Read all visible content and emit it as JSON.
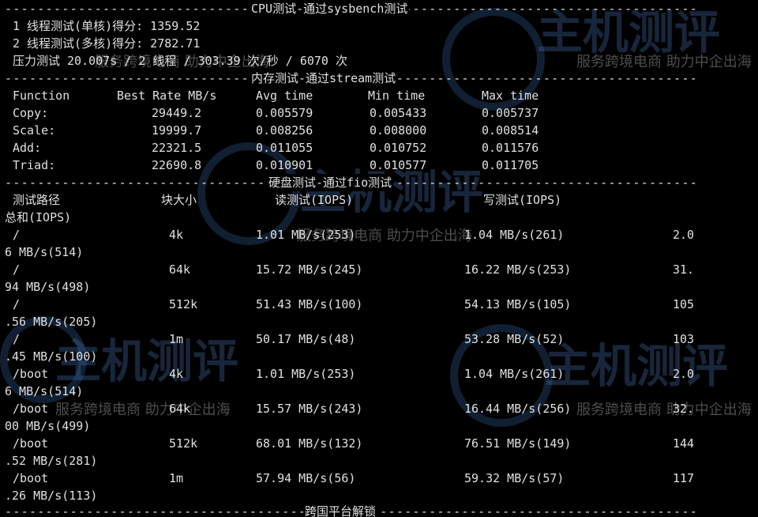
{
  "cpu": {
    "divider_title": "CPU测试-通过sysbench测试",
    "single_core": "1 线程测试(单核)得分: 1359.52",
    "multi_core": "2 线程测试(多核)得分: 2782.71",
    "stress": "压力测试 20.007s / 2 线程 / 303.39 次/秒 / 6070 次"
  },
  "memory": {
    "divider_title": "内存测试-通过stream测试",
    "headers": [
      "Function",
      "Best Rate MB/s",
      "Avg time",
      "Min time",
      "Max time"
    ],
    "rows": [
      [
        "Copy:",
        "29449.2",
        "0.005579",
        "0.005433",
        "0.005737"
      ],
      [
        "Scale:",
        "19999.7",
        "0.008256",
        "0.008000",
        "0.008514"
      ],
      [
        "Add:",
        "22321.5",
        "0.011055",
        "0.010752",
        "0.011576"
      ],
      [
        "Triad:",
        "22690.8",
        "0.010901",
        "0.010577",
        "0.011705"
      ]
    ]
  },
  "disk": {
    "divider_title": "硬盘测试-通过fio测试",
    "headers": [
      "测试路径",
      "块大小",
      "读测试(IOPS)",
      "写测试(IOPS)"
    ],
    "header_wrap": "总和(IOPS)",
    "rows": [
      {
        "path": "/",
        "block": "4k",
        "read": "1.01 MB/s(253)",
        "write": "1.04 MB/s(261)",
        "total_a": "2.0",
        "total_b": "6 MB/s(514)"
      },
      {
        "path": "/",
        "block": "64k",
        "read": "15.72 MB/s(245)",
        "write": "16.22 MB/s(253)",
        "total_a": "31.",
        "total_b": "94 MB/s(498)"
      },
      {
        "path": "/",
        "block": "512k",
        "read": "51.43 MB/s(100)",
        "write": "54.13 MB/s(105)",
        "total_a": "105",
        "total_b": ".56 MB/s(205)"
      },
      {
        "path": "/",
        "block": "1m",
        "read": "50.17 MB/s(48)",
        "write": "53.28 MB/s(52)",
        "total_a": "103",
        "total_b": ".45 MB/s(100)"
      },
      {
        "path": "/boot",
        "block": "4k",
        "read": "1.01 MB/s(253)",
        "write": "1.04 MB/s(261)",
        "total_a": "2.0",
        "total_b": "6 MB/s(514)"
      },
      {
        "path": "/boot",
        "block": "64k",
        "read": "15.57 MB/s(243)",
        "write": "16.44 MB/s(256)",
        "total_a": "32.",
        "total_b": "00 MB/s(499)"
      },
      {
        "path": "/boot",
        "block": "512k",
        "read": "68.01 MB/s(132)",
        "write": "76.51 MB/s(149)",
        "total_a": "144",
        "total_b": ".52 MB/s(281)"
      },
      {
        "path": "/boot",
        "block": "1m",
        "read": "57.94 MB/s(56)",
        "write": "59.32 MB/s(57)",
        "total_a": "117",
        "total_b": ".26 MB/s(113)"
      }
    ]
  },
  "unlock": {
    "divider_title": "跨国平台解锁"
  },
  "watermark": {
    "brand": "主机测评",
    "slogan": "服务跨境电商 助力中企出海"
  },
  "colors": {
    "background": "#000000",
    "text": "#e0e0e0",
    "watermark": "#466eaa"
  }
}
